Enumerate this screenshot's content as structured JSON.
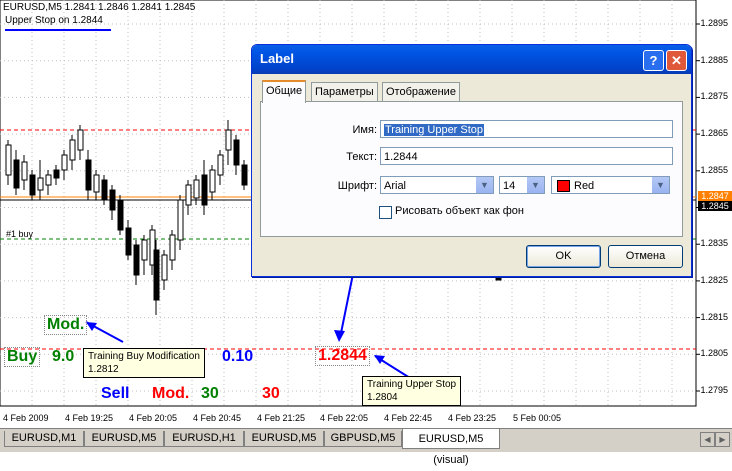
{
  "chart": {
    "symbol_line": "EURUSD,M5  1.2841 1.2846 1.2841 1.2845",
    "label_line": "Upper Stop on 1.2844",
    "price_ticks": [
      "1.2895",
      "1.2885",
      "1.2875",
      "1.2865",
      "1.2855",
      "1.2845",
      "1.2835",
      "1.2825",
      "1.2815",
      "1.2805",
      "1.2795"
    ],
    "time_ticks": [
      "4 Feb 2009",
      "4 Feb 19:25",
      "4 Feb 20:05",
      "4 Feb 20:45",
      "4 Feb 21:25",
      "4 Feb 22:05",
      "4 Feb 22:45",
      "4 Feb 23:25",
      "5 Feb 00:05"
    ],
    "current_price": "1.2847",
    "current_price2": "1.2845",
    "line_label": "#1 buy",
    "colors": {
      "bull": "#ffffff",
      "bear": "#000000",
      "grid": "#c0c0c0",
      "red_line": "#ff0000",
      "green_line": "#008000",
      "orange_line": "#ff8000",
      "blue": "#0000ff"
    }
  },
  "labels": {
    "mod_green": "Mod.",
    "buy": "Buy",
    "buy_value": "9.0",
    "blue_value": "0.10",
    "upper_stop_value": "1.2844",
    "sell": "Sell",
    "mod_red": "Mod.",
    "green_30": "30",
    "red_30": "30"
  },
  "tooltips": {
    "buy_mod_title": "Training Buy Modification",
    "buy_mod_value": "1.2812",
    "upper_stop_title": "Training Upper Stop",
    "upper_stop_value": "1.2804"
  },
  "dialog": {
    "title": "Label",
    "help": "?",
    "close": "✕",
    "tabs": [
      "Общие",
      "Параметры",
      "Отображение"
    ],
    "name_label": "Имя:",
    "name_value": "Training Upper Stop",
    "text_label": "Текст:",
    "text_value": "1.2844",
    "font_label": "Шрифт:",
    "font_value": "Arial",
    "size_value": "14",
    "color_value": "Red",
    "background_check": "Рисовать объект как фон",
    "ok": "OK",
    "cancel": "Отмена"
  },
  "tabs": {
    "items": [
      "EURUSD,M1",
      "EURUSD,M5",
      "EURUSD,H1",
      "EURUSD,M5",
      "GBPUSD,M5",
      "EURUSD,M5 (visual)"
    ],
    "active_index": 5,
    "prev_icon": "arrow-left-icon",
    "next_icon": "arrow-right-icon"
  }
}
